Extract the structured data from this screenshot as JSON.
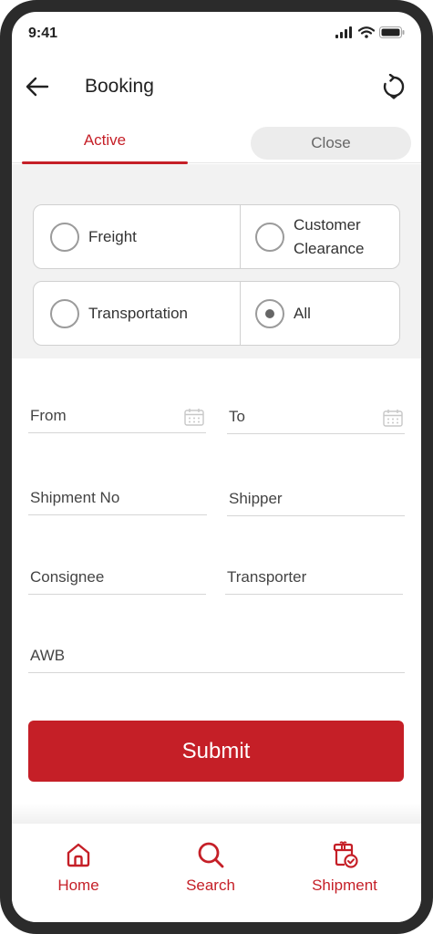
{
  "status_bar": {
    "time": "9:41"
  },
  "header": {
    "title": "Booking"
  },
  "tabs": [
    {
      "label": "Active"
    },
    {
      "label": "Close"
    }
  ],
  "options": {
    "freight": "Freight",
    "customer_clearance_line1": "Customer",
    "customer_clearance_line2": "Clearance",
    "transportation": "Transportation",
    "all": "All",
    "selected": "All"
  },
  "form": {
    "from_placeholder": "From",
    "to_placeholder": "To",
    "shipment_no_placeholder": "Shipment No",
    "shipper_placeholder": "Shipper",
    "consignee_placeholder": "Consignee",
    "transporter_placeholder": "Transporter",
    "awb_placeholder": "AWB",
    "submit_label": "Submit"
  },
  "bottom_nav": [
    {
      "label": "Home",
      "icon": "home-icon"
    },
    {
      "label": "Search",
      "icon": "search-icon"
    },
    {
      "label": "Shipment",
      "icon": "shipment-icon"
    }
  ],
  "colors": {
    "accent": "#c51f27",
    "filter_bg": "#f2f2f2",
    "tab_inactive_bg": "#ececec"
  }
}
